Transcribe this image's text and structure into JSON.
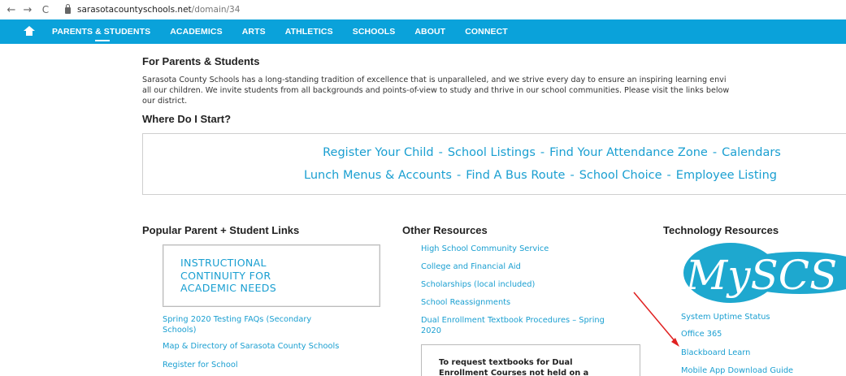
{
  "browser": {
    "back_icon": "←",
    "forward_icon": "→",
    "reload_icon": "C",
    "url_host": "sarasotacountyschools.net",
    "url_path": "/domain/34"
  },
  "nav": {
    "items": [
      "PARENTS & STUDENTS",
      "ACADEMICS",
      "ARTS",
      "ATHLETICS",
      "SCHOOLS",
      "ABOUT",
      "CONNECT"
    ],
    "bar_color": "#0aa2da"
  },
  "page": {
    "title": "For Parents & Students",
    "intro_lines": [
      "Sarasota County Schools has a long-standing tradition of excellence that is unparalleled, and we strive every day to ensure an inspiring learning envi",
      "all our children. We invite students from all backgrounds and points-of-view to study and thrive in our school communities. Please visit the links below",
      "our district."
    ],
    "where_heading": "Where Do I Start?",
    "start_row1": [
      "Register Your Child",
      "School Listings",
      "Find Your Attendance Zone",
      "Calendars"
    ],
    "start_row2": [
      "Lunch Menus & Accounts",
      "Find A Bus Route",
      "School Choice",
      "Employee Listing"
    ],
    "separator": "-"
  },
  "popular": {
    "heading": "Popular Parent + Student Links",
    "box_lines": [
      "INSTRUCTIONAL",
      "CONTINUITY FOR",
      "ACADEMIC NEEDS"
    ],
    "links": [
      [
        "Spring 2020 Testing FAQs (Secondary",
        "Schools)"
      ],
      [
        "Map & Directory of Sarasota County Schools"
      ],
      [
        "Register for School"
      ]
    ]
  },
  "other": {
    "heading": "Other Resources",
    "links": [
      [
        "High School Community Service"
      ],
      [
        "College and Financial Aid"
      ],
      [
        "Scholarships (local included)"
      ],
      [
        "School Reassignments"
      ],
      [
        "Dual Enrollment Textbook Procedures – Spring",
        "2020"
      ]
    ],
    "note_lines": [
      "To request textbooks for Dual",
      "Enrollment Courses not held on a"
    ]
  },
  "tech": {
    "heading": "Technology Resources",
    "logo_text": "MySCS",
    "links": [
      "System Uptime Status",
      "Office 365",
      "Blackboard Learn",
      "Mobile App Download Guide"
    ]
  },
  "colors": {
    "link": "#1a9fd1",
    "annotation_arrow": "#e02020"
  }
}
